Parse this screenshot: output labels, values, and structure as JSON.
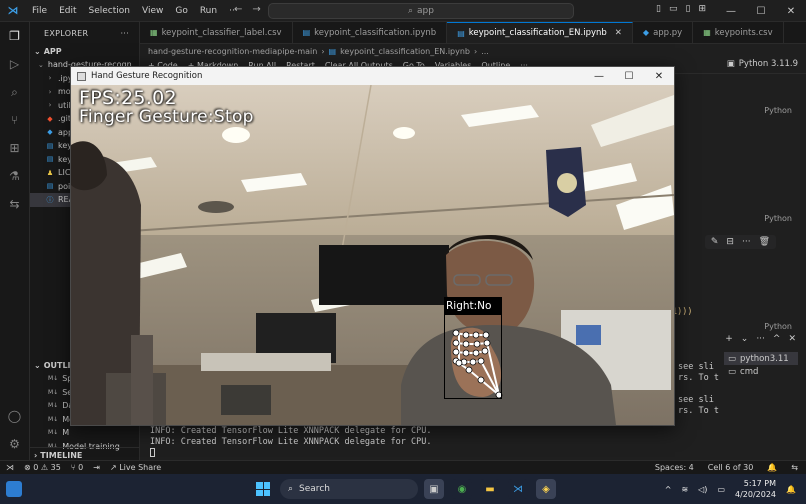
{
  "window": {
    "menu": [
      "File",
      "Edit",
      "Selection",
      "View",
      "Go",
      "Run",
      "···"
    ],
    "search_text": "app"
  },
  "sidebar": {
    "header": "EXPLORER",
    "section": "APP",
    "root_folder": "hand-gesture-recogn...",
    "items": [
      {
        "icon": "›",
        "label": ".ipy"
      },
      {
        "icon": "›",
        "label": "mod"
      },
      {
        "icon": "›",
        "label": "utils"
      },
      {
        "icon": "◆",
        "label": ".gitig"
      },
      {
        "icon": "◆",
        "label": "app."
      },
      {
        "icon": "▤",
        "label": "keyp"
      },
      {
        "icon": "▤",
        "label": "keyp"
      },
      {
        "icon": "♟",
        "label": "LICE"
      },
      {
        "icon": "▤",
        "label": "poin"
      },
      {
        "icon": "ⓘ",
        "label": "REA"
      }
    ],
    "outline_header": "OUTLINE",
    "outline_items": [
      "Sp",
      "Se",
      "Da",
      "Mo",
      "M",
      "Model training"
    ],
    "timeline_header": "TIMELINE"
  },
  "editor": {
    "tabs": [
      {
        "label": "keypoint_classifier_label.csv",
        "active": false
      },
      {
        "label": "keypoint_classification.ipynb",
        "active": false
      },
      {
        "label": "keypoint_classification_EN.ipynb",
        "active": true
      },
      {
        "label": "app.py",
        "active": false
      },
      {
        "label": "keypoints.csv",
        "active": false
      }
    ],
    "breadcrumb": [
      "hand-gesture-recognition-mediapipe-main",
      "keypoint_classification_EN.ipynb",
      "..."
    ],
    "toolbar": [
      "+ Code",
      "+ Markdown",
      "Run All",
      "Restart",
      "Clear All Outputs",
      "Go To",
      "Variables",
      "Outline",
      "···"
    ],
    "kernel": "Python 3.11.9",
    "lang_label": "Python",
    "code_fragment": "1)))",
    "terminal_tabs": [
      "python3.11",
      "cmd"
    ],
    "right_fragments": [
      "see sli",
      "rs. To t",
      "see sli",
      "rs. To t"
    ],
    "terminal_lines": [
      "INFO: Created TensorFlow Lite XNNPACK delegate for CPU.",
      "INFO: Created TensorFlow Lite XNNPACK delegate for CPU."
    ]
  },
  "status": {
    "errors": "0",
    "warnings": "35",
    "ports": "0",
    "live_share": "Live Share",
    "spaces": "Spaces: 4",
    "cell": "Cell 6 of 30"
  },
  "gesture_window": {
    "title": "Hand Gesture Recognition",
    "fps_text": "FPS:25.02",
    "gesture_text": "Finger Gesture:Stop",
    "hand_label": "Right:No"
  },
  "taskbar": {
    "search": "Search",
    "time": "5:17 PM",
    "date": "4/20/2024"
  }
}
